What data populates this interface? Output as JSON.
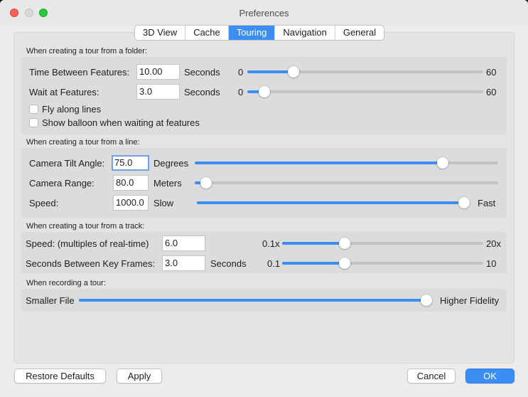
{
  "window": {
    "title": "Preferences"
  },
  "tabs": [
    {
      "label": "3D View"
    },
    {
      "label": "Cache"
    },
    {
      "label": "Touring",
      "active": true
    },
    {
      "label": "Navigation"
    },
    {
      "label": "General"
    }
  ],
  "folder": {
    "heading": "When creating a tour from a folder:",
    "time_between": {
      "label": "Time Between Features:",
      "value": "10.00",
      "unit": "Seconds",
      "min": "0",
      "max": "60",
      "level": 0.18
    },
    "wait_at": {
      "label": "Wait at Features:",
      "value": "3.0",
      "unit": "Seconds",
      "min": "0",
      "max": "60",
      "level": 0.05
    },
    "fly_along": {
      "label": "Fly along lines",
      "checked": false
    },
    "show_balloon": {
      "label": "Show balloon when waiting at features",
      "checked": false
    }
  },
  "line": {
    "heading": "When creating a tour from a line:",
    "tilt": {
      "label": "Camera Tilt Angle:",
      "value": "75.0",
      "unit": "Degrees",
      "level": 0.83
    },
    "range": {
      "label": "Camera Range:",
      "value": "80.0",
      "unit": "Meters",
      "level": 0.02
    },
    "speed": {
      "label": "Speed:",
      "value": "1000.0",
      "min": "Slow",
      "max": "Fast",
      "level": 1.0
    }
  },
  "track": {
    "heading": "When creating a tour from a track:",
    "speed": {
      "label": "Speed: (multiples of real-time)",
      "value": "6.0",
      "min": "0.1x",
      "max": "20x",
      "level": 0.3
    },
    "keyframes": {
      "label": "Seconds Between Key Frames:",
      "value": "3.0",
      "unit": "Seconds",
      "min": "0.1",
      "max": "10",
      "level": 0.3
    }
  },
  "recording": {
    "heading": "When recording a tour:",
    "min": "Smaller File",
    "max": "Higher Fidelity",
    "level": 1.0
  },
  "buttons": {
    "restore": "Restore Defaults",
    "apply": "Apply",
    "cancel": "Cancel",
    "ok": "OK"
  },
  "colors": {
    "accent": "#3b8ef5"
  }
}
